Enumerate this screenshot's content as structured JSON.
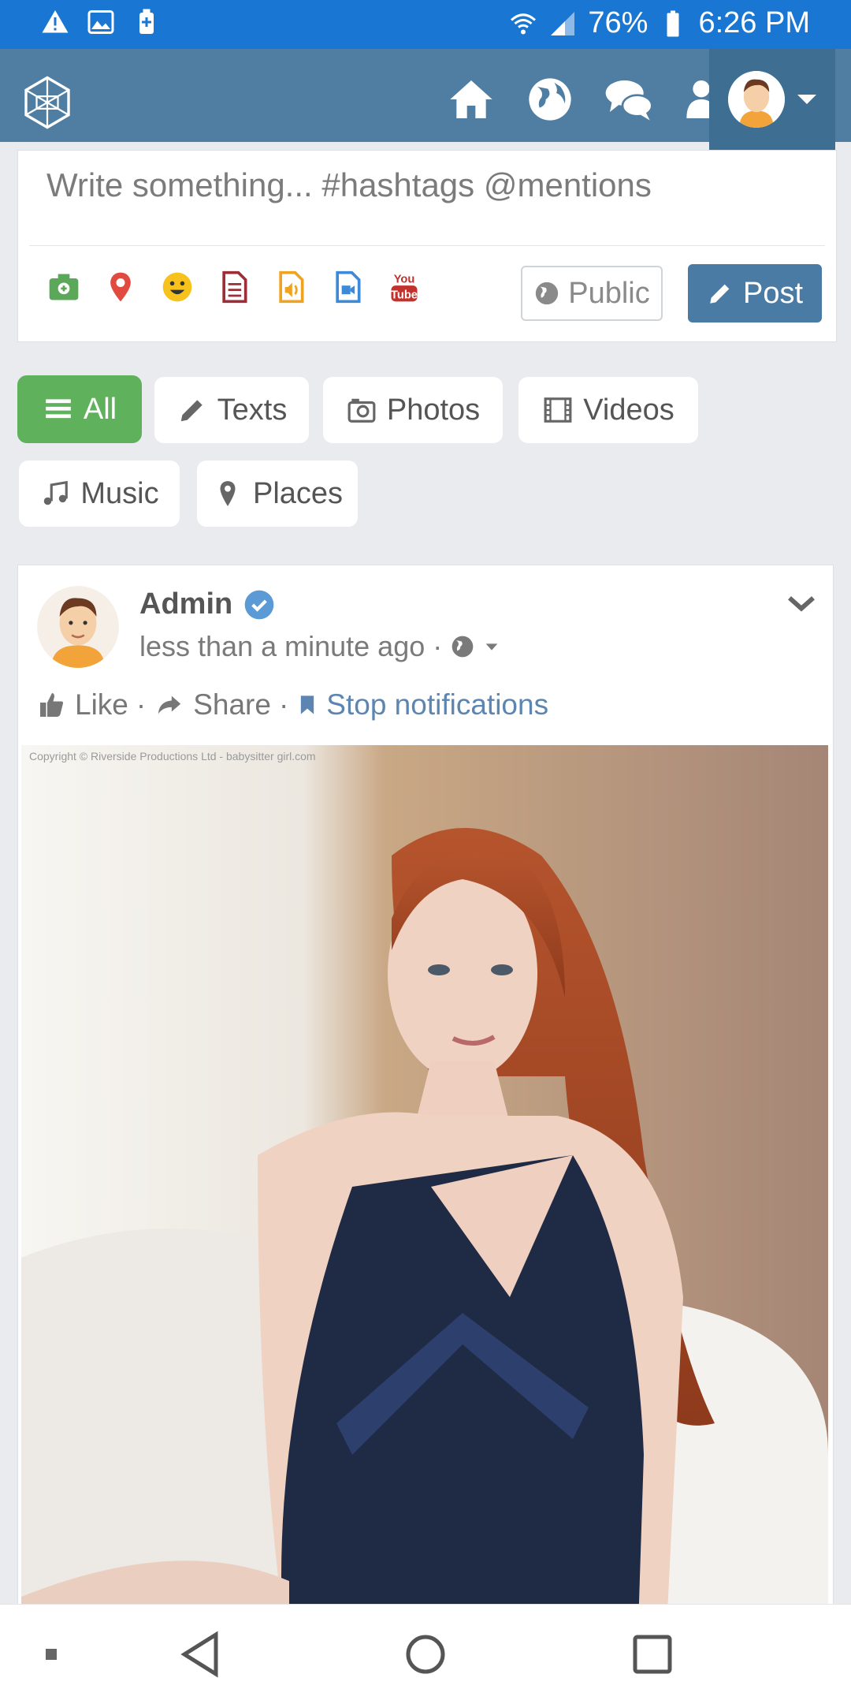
{
  "status_bar": {
    "battery": "76%",
    "time": "6:26 PM"
  },
  "composer": {
    "placeholder": "Write something... #hashtags @mentions",
    "privacy_label": "Public",
    "post_label": "Post"
  },
  "filters": [
    {
      "label": "All",
      "icon": "list-icon",
      "active": true
    },
    {
      "label": "Texts",
      "icon": "pencil-icon",
      "active": false
    },
    {
      "label": "Photos",
      "icon": "camera-icon",
      "active": false
    },
    {
      "label": "Videos",
      "icon": "film-icon",
      "active": false
    },
    {
      "label": "Music",
      "icon": "music-note-icon",
      "active": false
    },
    {
      "label": "Places",
      "icon": "map-pin-icon",
      "active": false
    }
  ],
  "post": {
    "author": "Admin",
    "time": "less than a minute ago ·",
    "actions": {
      "like": "Like",
      "share": "Share",
      "stop_notifications": "Stop notifications",
      "separator": "·"
    },
    "photo_watermark": "Copyright © Riverside Productions Ltd - babysitter girl.com"
  },
  "colors": {
    "status_bar": "#1976d2",
    "top_nav": "#4f7ea2",
    "post_button": "#4a7ba4",
    "active_filter": "#5fb25b",
    "link_blue": "#5c86b1"
  }
}
